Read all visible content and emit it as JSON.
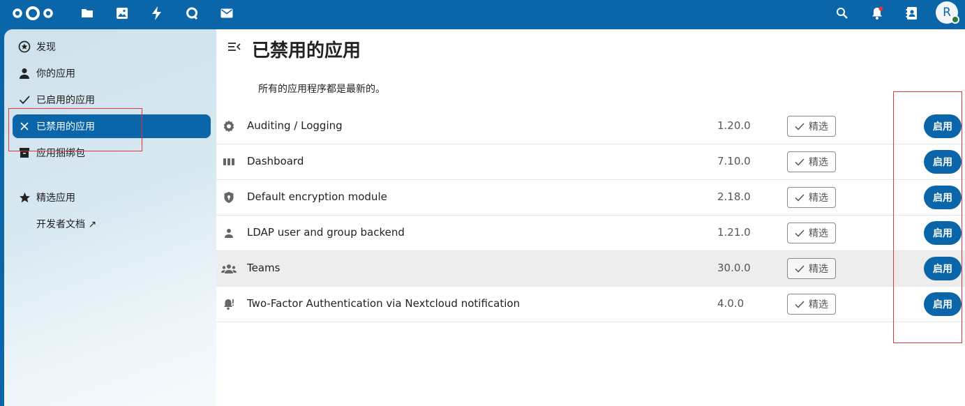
{
  "header": {
    "apps": [
      "files-icon",
      "photos-icon",
      "activity-icon",
      "talk-icon",
      "mail-icon"
    ],
    "right": [
      "search-icon",
      "notifications-icon",
      "contacts-icon"
    ],
    "avatar_initial": "R",
    "colors": {
      "primary": "#0a66a8",
      "status_online": "#2d7b41"
    }
  },
  "sidebar": {
    "items": [
      {
        "label": "发现",
        "icon": "star-circle-icon"
      },
      {
        "label": "你的应用",
        "icon": "account-icon"
      },
      {
        "label": "已启用的应用",
        "icon": "check-icon"
      },
      {
        "label": "已禁用的应用",
        "icon": "close-icon",
        "active": true
      },
      {
        "label": "应用捆绑包",
        "icon": "archive-icon"
      },
      {
        "label": "精选应用",
        "icon": "star-icon"
      },
      {
        "label": "开发者文档 ↗",
        "icon": ""
      }
    ]
  },
  "main": {
    "title": "已禁用的应用",
    "update_message": "所有的应用程序都是最新的。",
    "featured_label": "精选",
    "enable_label": "启用",
    "apps": [
      {
        "name": "Auditing / Logging",
        "version": "1.20.0",
        "icon": "gear-icon"
      },
      {
        "name": "Dashboard",
        "version": "7.10.0",
        "icon": "dashboard-icon"
      },
      {
        "name": "Default encryption module",
        "version": "2.18.0",
        "icon": "shield-icon"
      },
      {
        "name": "LDAP user and group backend",
        "version": "1.21.0",
        "icon": "user-icon"
      },
      {
        "name": "Teams",
        "version": "30.0.0",
        "icon": "group-icon",
        "hovered": true
      },
      {
        "name": "Two-Factor Authentication via Nextcloud notification",
        "version": "4.0.0",
        "icon": "bell-alert-icon"
      }
    ]
  },
  "annotations": {
    "highlight_color": "#e0353f"
  }
}
